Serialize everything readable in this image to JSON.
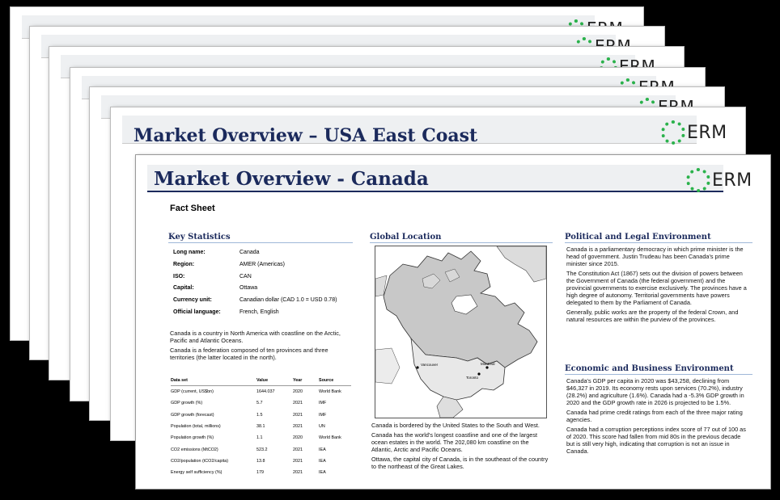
{
  "back_slides": [
    {
      "logo_text": "ERM"
    },
    {
      "logo_text": "ERM"
    },
    {
      "logo_text": "ERM"
    },
    {
      "logo_text": "ERM"
    },
    {
      "logo_text": "ERM"
    }
  ],
  "second_slide": {
    "title": "Market Overview – USA East Coast",
    "logo_text": "ERM"
  },
  "front_slide": {
    "title": "Market Overview - Canada",
    "logo_text": "ERM",
    "fact_sheet": "Fact Sheet",
    "key_statistics": {
      "heading": "Key Statistics",
      "rows": [
        {
          "label": "Long name:",
          "value": "Canada"
        },
        {
          "label": "Region:",
          "value": "AMER (Americas)"
        },
        {
          "label": "ISO:",
          "value": "CAN"
        },
        {
          "label": "Capital:",
          "value": "Ottawa"
        },
        {
          "label": "Currency unit:",
          "value": "Canadian dollar (CAD 1.0 = USD 0.78)"
        },
        {
          "label": "Official language:",
          "value": "French, English"
        }
      ],
      "intro_1": "Canada is a country in North America with coastline on the Arctic, Pacific and Atlantic Oceans.",
      "intro_2": "Canada is a federation composed of ten provinces and three territories (the latter located in the north)."
    },
    "dataset": {
      "headers": [
        "Data set",
        "Value",
        "Year",
        "Source"
      ],
      "rows": [
        [
          "GDP (current, US$bn)",
          "1644.037",
          "2020",
          "World Bank"
        ],
        [
          "GDP growth (%)",
          "5.7",
          "2021",
          "IMF"
        ],
        [
          "GDP growth (forecast)",
          "1.5",
          "2021",
          "IMF"
        ],
        [
          "Population (total, millions)",
          "38.1",
          "2021",
          "UN"
        ],
        [
          "Population growth (%)",
          "1.1",
          "2020",
          "World Bank"
        ],
        [
          "CO2 emissions (MtCO2)",
          "523.2",
          "2021",
          "IEA"
        ],
        [
          "CO2/population (tCO2/capita)",
          "13.8",
          "2021",
          "IEA"
        ],
        [
          "Energy self sufficiency (%)",
          "179",
          "2021",
          "IEA"
        ]
      ]
    },
    "global_location": {
      "heading": "Global Location",
      "map_labels": [
        "Vancouver",
        "Montreal",
        "Toronto"
      ],
      "text_1": "Canada is bordered by the United States to the South and West.",
      "text_2": "Canada has the world's longest coastline and one of the largest ocean estates in the world. The 202,080 km coastline on the Atlantic, Arctic and Pacific Oceans.",
      "text_3": "Ottawa, the capital city of Canada, is in the southeast of the country to the northeast of the Great Lakes."
    },
    "political": {
      "heading": "Political and Legal Environment",
      "p1": "Canada is a parliamentary democracy in which prime minister is the head of government. Justin Trudeau has been Canada's prime minister since 2015.",
      "p2": "The Constitution Act (1867) sets out the division of powers between the Government of Canada (the federal government) and the provincial governments to exercise exclusively. The provinces have a high degree of autonomy. Territorial governments have powers delegated to them by the Parliament of Canada.",
      "p3": "Generally, public works are the property of the federal Crown, and natural resources are within the purview of the provinces."
    },
    "economic": {
      "heading": "Economic and Business Environment",
      "p1": "Canada's GDP per capita in 2020 was $43,258, declining from $46,327 in 2019. Its economy rests upon services (70.2%), industry (28.2%) and agriculture (1.6%). Canada had a -5.3% GDP growth in 2020 and the GDP growth rate in 2026 is projected to be 1.5%.",
      "p2": "Canada had prime credit ratings from each of the three major rating agencies.",
      "p3": "Canada had a corruption perceptions index score of 77 out of 100 as of 2020. This score had fallen from mid 80s in the previous decade but is still very high, indicating that corruption is not an issue in Canada."
    }
  }
}
